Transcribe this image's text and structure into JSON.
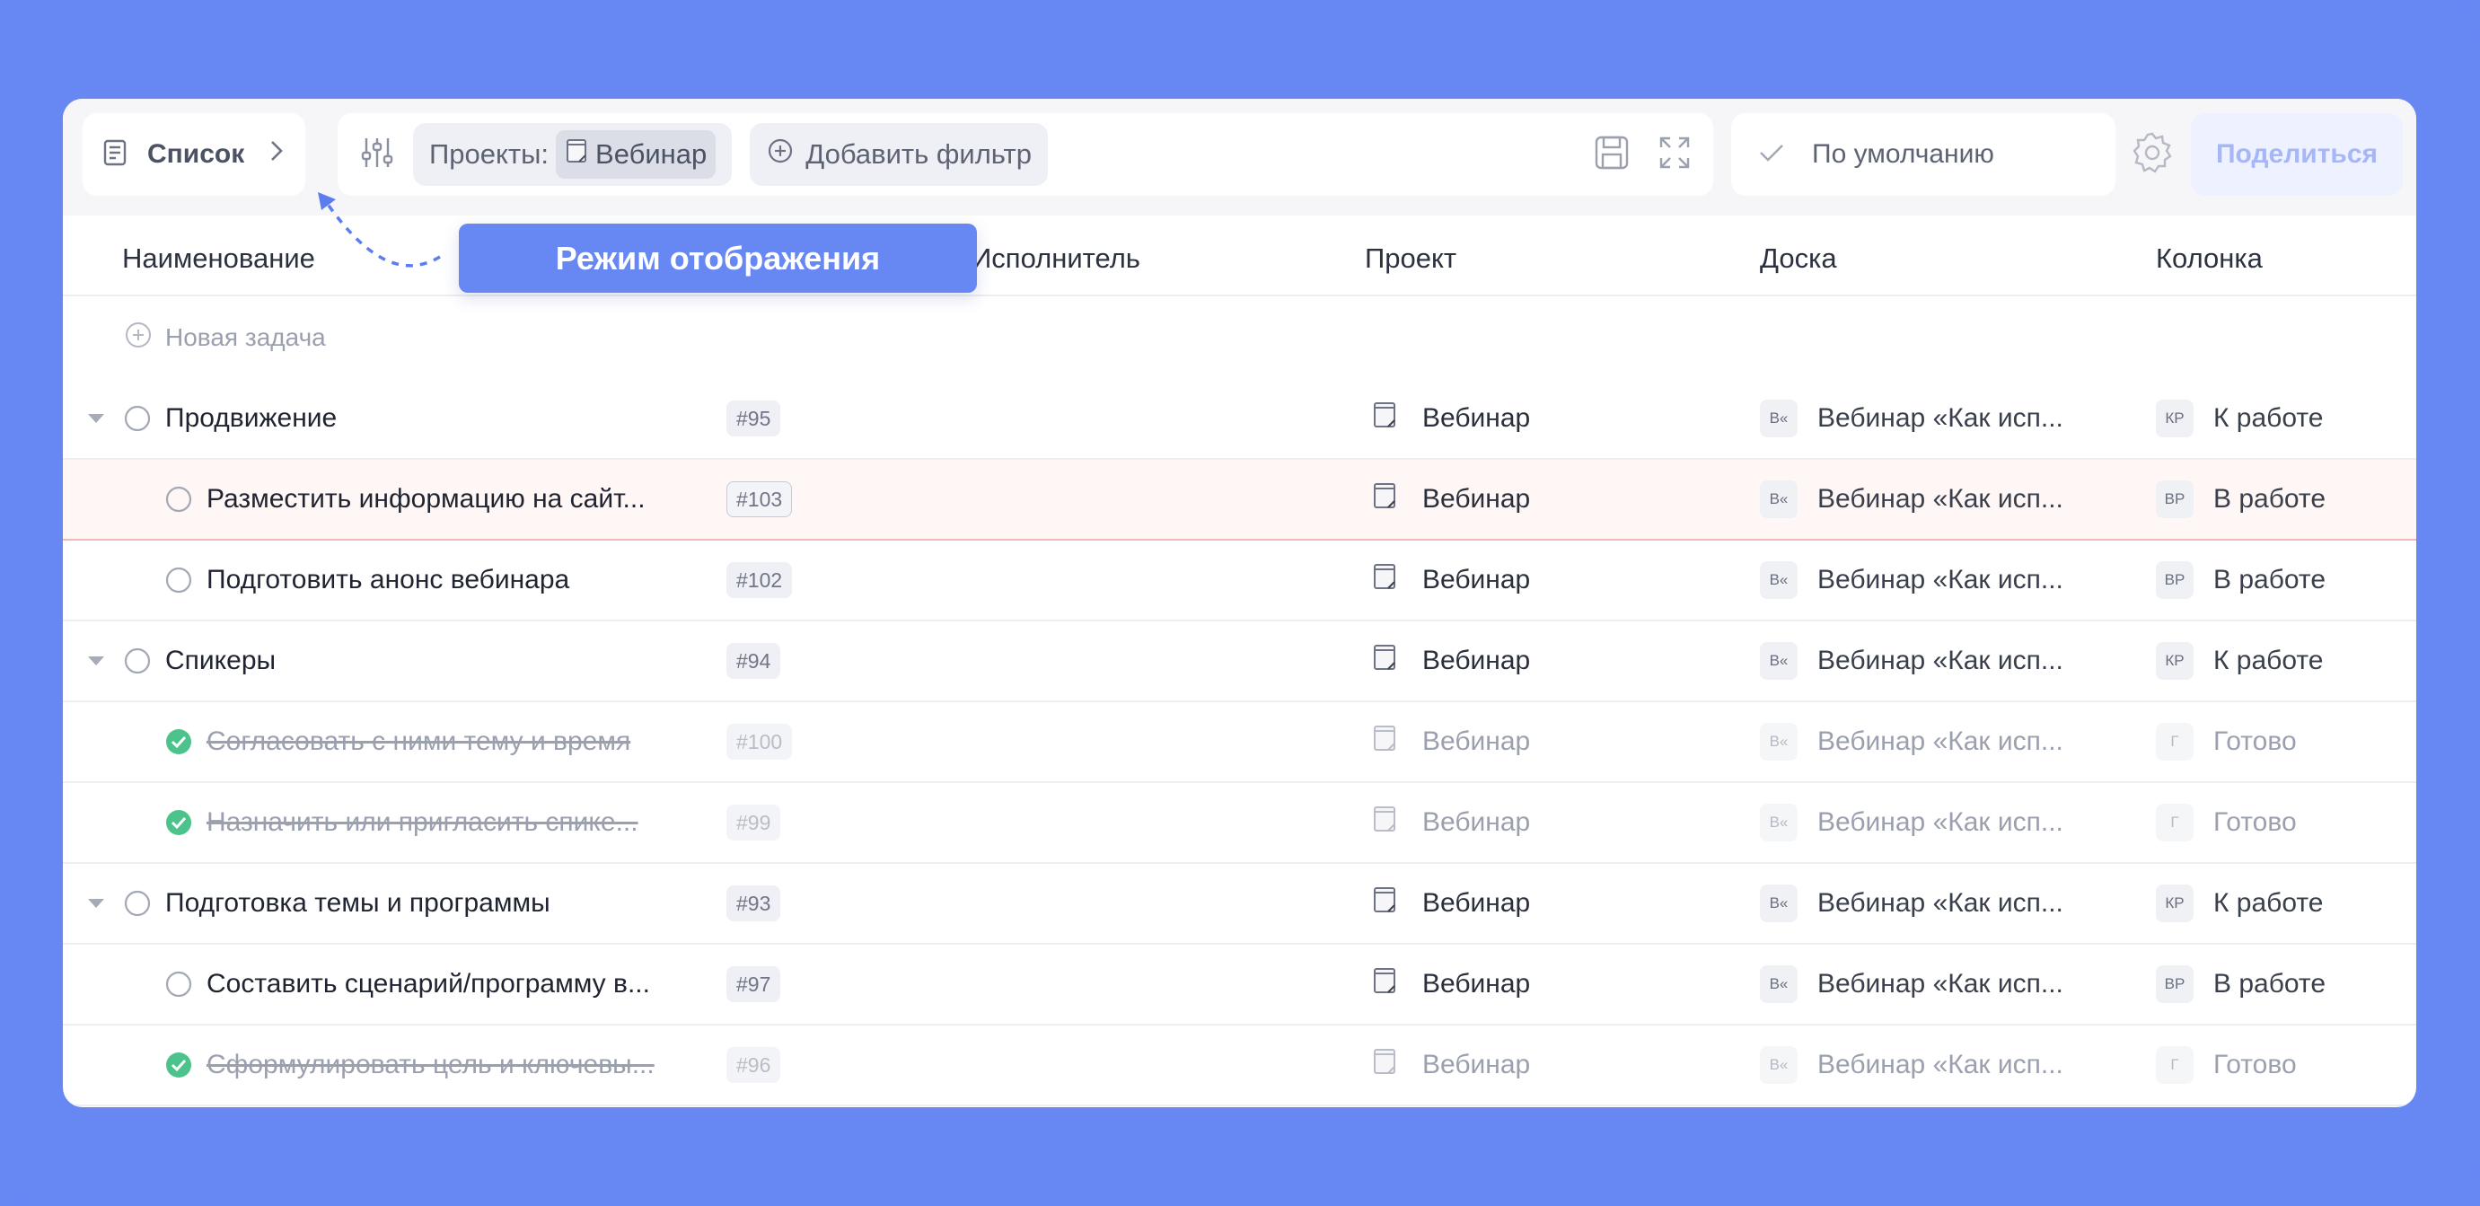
{
  "toolbar": {
    "view_label": "Список",
    "filter_projects_label": "Проекты:",
    "filter_project_value": "Вебинар",
    "add_filter_label": "Добавить фильтр",
    "sort_label": "По умолчанию",
    "share_label": "Поделиться"
  },
  "tooltip": {
    "text": "Режим отображения"
  },
  "columns": {
    "name": "Наименование",
    "assignee": "Исполнитель",
    "project": "Проект",
    "board": "Доска",
    "column": "Колонка"
  },
  "new_task_label": "Новая задача",
  "rows": [
    {
      "level": 0,
      "done": false,
      "highlight": false,
      "name": "Продвижение",
      "id": "#95",
      "project": "Вебинар",
      "board_badge": "В«",
      "board": "Вебинар «Как исп...",
      "col_badge": "КР",
      "column": "К работе"
    },
    {
      "level": 1,
      "done": false,
      "highlight": true,
      "name": "Разместить информацию на сайт...",
      "id": "#103",
      "project": "Вебинар",
      "board_badge": "В«",
      "board": "Вебинар «Как исп...",
      "col_badge": "ВР",
      "column": "В работе"
    },
    {
      "level": 1,
      "done": false,
      "highlight": false,
      "name": "Подготовить анонс вебинара",
      "id": "#102",
      "project": "Вебинар",
      "board_badge": "В«",
      "board": "Вебинар «Как исп...",
      "col_badge": "ВР",
      "column": "В работе"
    },
    {
      "level": 0,
      "done": false,
      "highlight": false,
      "name": "Спикеры",
      "id": "#94",
      "project": "Вебинар",
      "board_badge": "В«",
      "board": "Вебинар «Как исп...",
      "col_badge": "КР",
      "column": "К работе"
    },
    {
      "level": 1,
      "done": true,
      "highlight": false,
      "name": "Согласовать с ними тему и время",
      "id": "#100",
      "project": "Вебинар",
      "board_badge": "В«",
      "board": "Вебинар «Как исп...",
      "col_badge": "Г",
      "column": "Готово"
    },
    {
      "level": 1,
      "done": true,
      "highlight": false,
      "name": "Назначить или пригласить спике...",
      "id": "#99",
      "project": "Вебинар",
      "board_badge": "В«",
      "board": "Вебинар «Как исп...",
      "col_badge": "Г",
      "column": "Готово"
    },
    {
      "level": 0,
      "done": false,
      "highlight": false,
      "name": "Подготовка темы и программы",
      "id": "#93",
      "project": "Вебинар",
      "board_badge": "В«",
      "board": "Вебинар «Как исп...",
      "col_badge": "КР",
      "column": "К работе"
    },
    {
      "level": 1,
      "done": false,
      "highlight": false,
      "name": "Составить сценарий/программу в...",
      "id": "#97",
      "project": "Вебинар",
      "board_badge": "В«",
      "board": "Вебинар «Как исп...",
      "col_badge": "ВР",
      "column": "В работе"
    },
    {
      "level": 1,
      "done": true,
      "highlight": false,
      "name": "Сформулировать цель и ключевы...",
      "id": "#96",
      "project": "Вебинар",
      "board_badge": "В«",
      "board": "Вебинар «Как исп...",
      "col_badge": "Г",
      "column": "Готово"
    }
  ],
  "colors": {
    "background": "#6787f3",
    "accent": "#6787f3",
    "done_green": "#4cc38a",
    "highlight_border": "#f4b6b6"
  },
  "icons": {
    "view": "list-icon",
    "filters": "sliders-icon",
    "project": "document-icon",
    "add_filter": "plus-circle-icon",
    "save": "save-icon",
    "expand": "expand-icon",
    "sort": "check-icon",
    "settings": "gear-icon",
    "collapse": "caret-down-icon"
  }
}
